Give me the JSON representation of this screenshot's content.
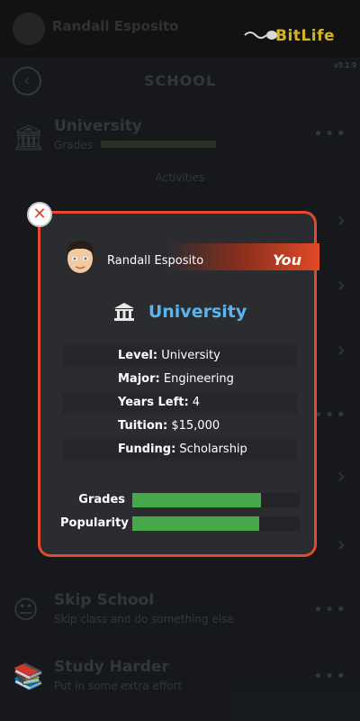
{
  "app": {
    "logo_text": "BitLife",
    "version": "v3.1.9"
  },
  "background": {
    "header_name": "Randall Esposito",
    "screen_title": "SCHOOL",
    "current_school": {
      "title": "University",
      "sub": "Grades"
    },
    "section_label": "Activities",
    "rows": [
      {
        "title": "Skip School",
        "sub": "Skip class and do something else"
      },
      {
        "title": "Study Harder",
        "sub": "Put in some extra effort"
      }
    ]
  },
  "modal": {
    "person_name": "Randall Esposito",
    "you_label": "You",
    "school_name": "University",
    "info": [
      {
        "label": "Level:",
        "value": "University"
      },
      {
        "label": "Major:",
        "value": "Engineering"
      },
      {
        "label": "Years Left:",
        "value": "4"
      },
      {
        "label": "Tuition:",
        "value": "$15,000"
      },
      {
        "label": "Funding:",
        "value": "Scholarship"
      }
    ],
    "stats": [
      {
        "label": "Grades",
        "percent": 77
      },
      {
        "label": "Popularity",
        "percent": 76
      }
    ]
  },
  "colors": {
    "accent": "#e14a2e",
    "school_blue": "#5ab4ee",
    "bar_green": "#45a849",
    "logo_yellow": "#f7d52b"
  }
}
